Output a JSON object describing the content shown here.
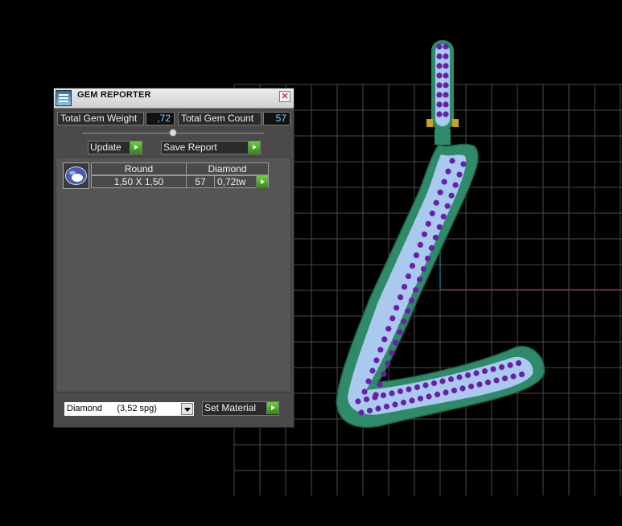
{
  "window": {
    "title": "GEM REPORTER",
    "close_glyph": "✕"
  },
  "stats": {
    "weight_label": "Total Gem Weight",
    "weight_value": ",72",
    "count_label": "Total Gem Count",
    "count_value": "57"
  },
  "buttons": {
    "update": "Update",
    "save_report": "Save Report",
    "set_material": "Set Material"
  },
  "gem_list": [
    {
      "icon": "round-gem-icon",
      "shape": "Round",
      "size": "1,50 X 1,50",
      "material": "Diamond",
      "count": "57",
      "weight": "0,72tw"
    }
  ],
  "material_select": {
    "selected": "Diamond      (3,52 spg)"
  },
  "colors": {
    "ring_metal": "#2f8a6a",
    "ring_fill": "#a9c9ee",
    "gems": "#6a1fa8",
    "grid": "#4a4a4a",
    "x_axis": "#b22222",
    "y_axis": "#2aa8a8",
    "accent_value": "#7fd0ff",
    "go_button": "#3fa61f"
  }
}
